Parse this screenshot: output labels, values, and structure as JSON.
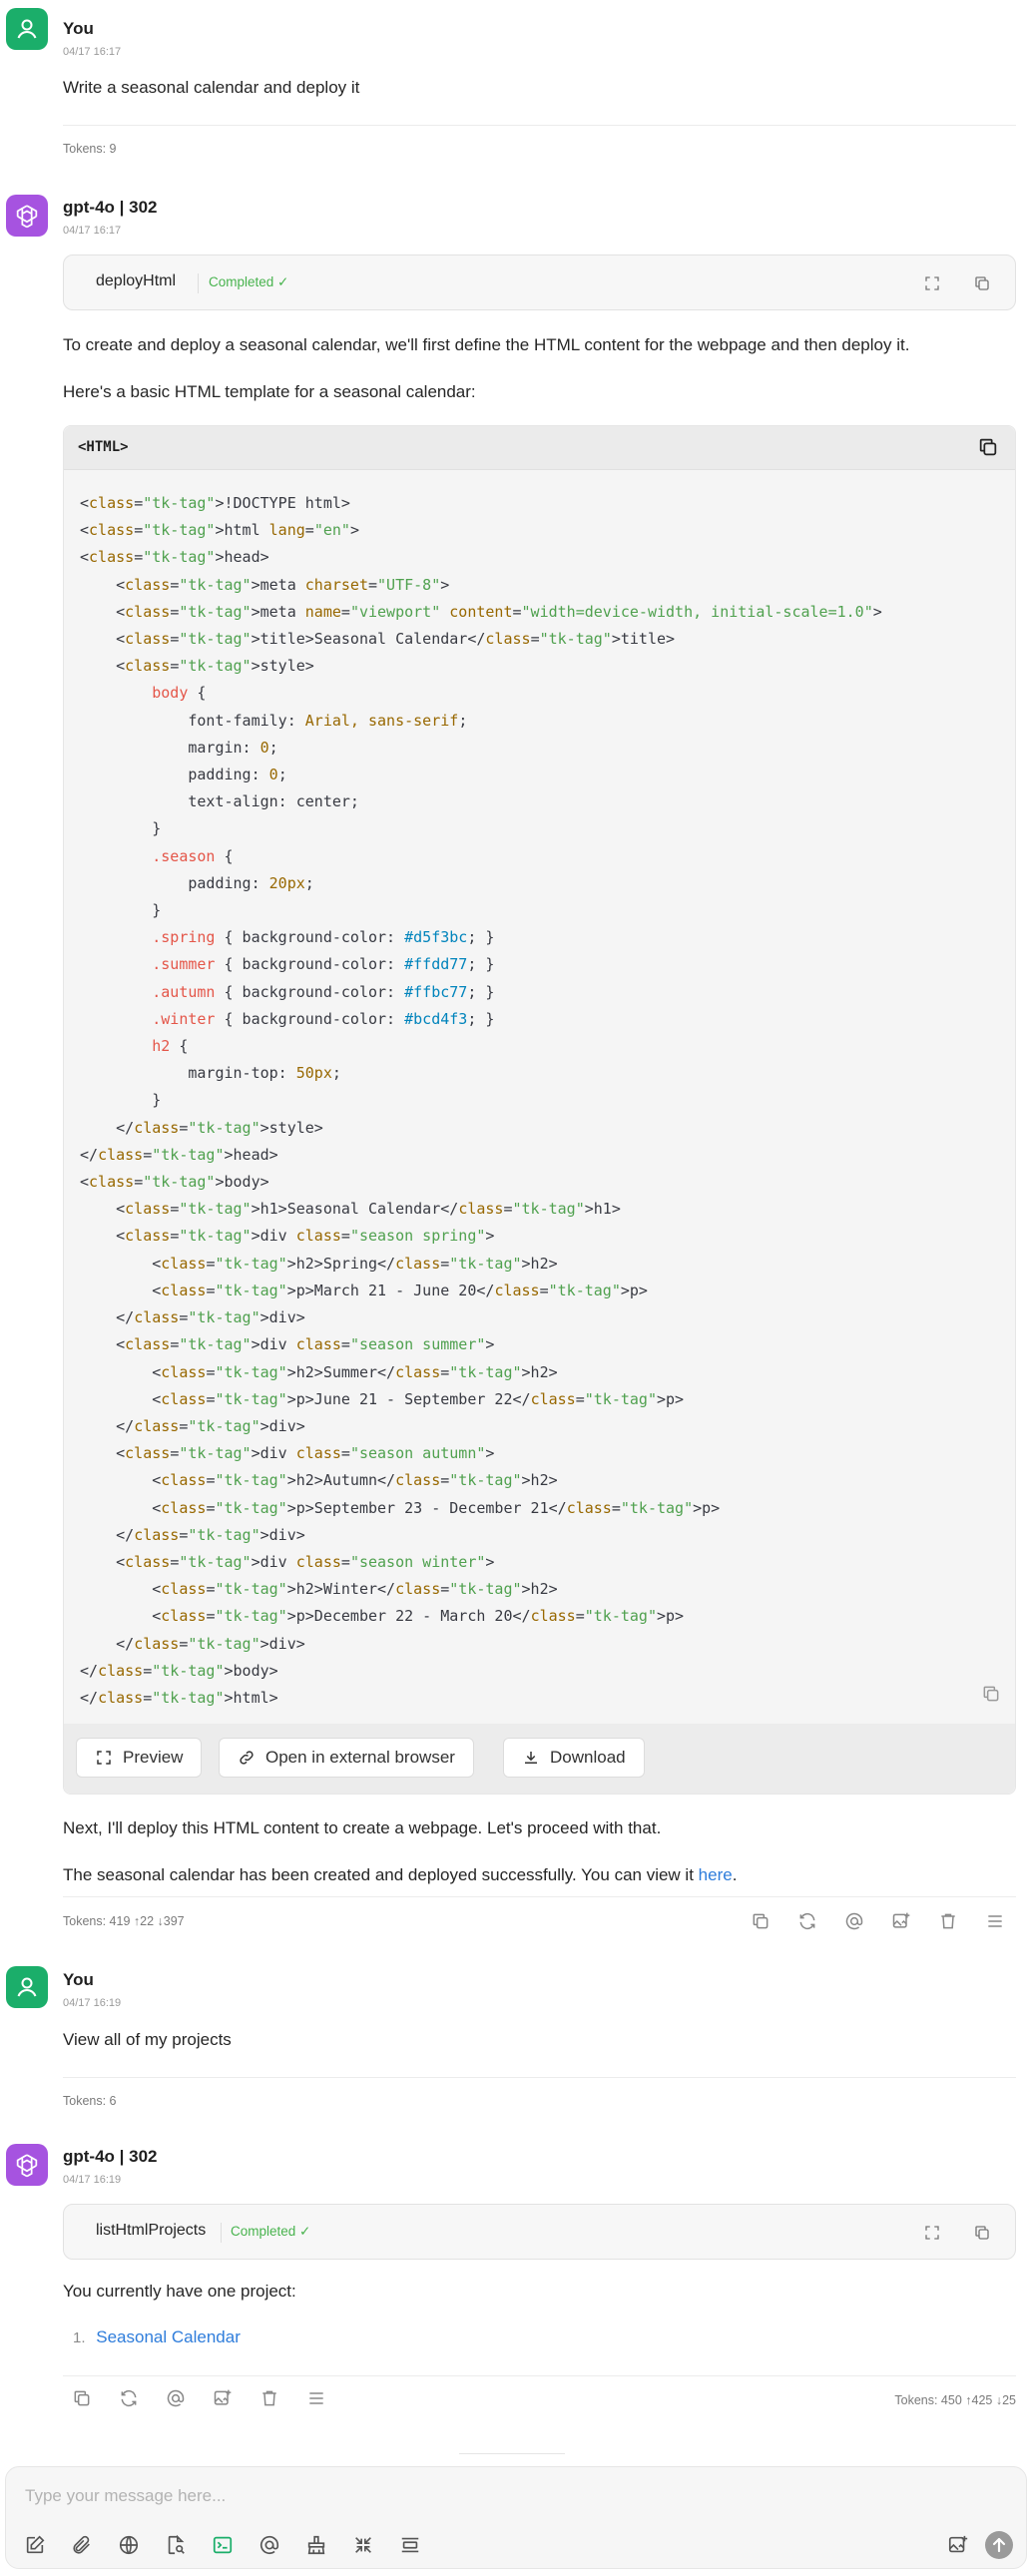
{
  "messages": {
    "m1": {
      "author": "You",
      "time": "04/17 16:17",
      "text": "Write a seasonal calendar and deploy it",
      "tokens": "Tokens: 9"
    },
    "m2": {
      "author": "gpt-4o | 302",
      "time": "04/17 16:17",
      "tool_name": "deployHtml",
      "tool_status": "Completed ✓",
      "p1": "To create and deploy a seasonal calendar, we'll first define the HTML content for the webpage and then deploy it.",
      "p2": "Here's a basic HTML template for a seasonal calendar:",
      "code_lang": "<HTML>",
      "code_lines": {
        "l1": "<!DOCTYPE html>",
        "l2": "<html lang=\"en\">",
        "l3": "<head>",
        "l4": "    <meta charset=\"UTF-8\">",
        "l5": "    <meta name=\"viewport\" content=\"width=device-width, initial-scale=1.0\">",
        "l6": "    <title>Seasonal Calendar</title>",
        "l7": "    <style>",
        "l8": "        body {",
        "l9": "            font-family: Arial, sans-serif;",
        "l10": "            margin: 0;",
        "l11": "            padding: 0;",
        "l12": "            text-align: center;",
        "l13": "        }",
        "l14": "        .season {",
        "l15": "            padding: 20px;",
        "l16": "        }",
        "l17": "        .spring { background-color: #d5f3bc; }",
        "l18": "        .summer { background-color: #ffdd77; }",
        "l19": "        .autumn { background-color: #ffbc77; }",
        "l20": "        .winter { background-color: #bcd4f3; }",
        "l21": "        h2 {",
        "l22": "            margin-top: 50px;",
        "l23": "        }",
        "l24": "    </style>",
        "l25": "</head>",
        "l26": "<body>",
        "l27": "    <h1>Seasonal Calendar</h1>",
        "l28": "    <div class=\"season spring\">",
        "l29": "        <h2>Spring</h2>",
        "l30": "        <p>March 21 - June 20</p>",
        "l31": "    </div>",
        "l32": "    <div class=\"season summer\">",
        "l33": "        <h2>Summer</h2>",
        "l34": "        <p>June 21 - September 22</p>",
        "l35": "    </div>",
        "l36": "    <div class=\"season autumn\">",
        "l37": "        <h2>Autumn</h2>",
        "l38": "        <p>September 23 - December 21</p>",
        "l39": "    </div>",
        "l40": "    <div class=\"season winter\">",
        "l41": "        <h2>Winter</h2>",
        "l42": "        <p>December 22 - March 20</p>",
        "l43": "    </div>",
        "l44": "</body>",
        "l45": "</html>"
      },
      "preview_label": "Preview",
      "open_external_label": "Open in external browser",
      "download_label": "Download",
      "p3": "Next, I'll deploy this HTML content to create a webpage. Let's proceed with that.",
      "p4_before": "The seasonal calendar has been created and deployed successfully. You can view it ",
      "p4_link": "here",
      "p4_after": ".",
      "tokens": "Tokens: 419 ↑22 ↓397"
    },
    "m3": {
      "author": "You",
      "time": "04/17 16:19",
      "text": "View all of my projects",
      "tokens": "Tokens: 6"
    },
    "m4": {
      "author": "gpt-4o | 302",
      "time": "04/17 16:19",
      "tool_name": "listHtmlProjects",
      "tool_status": "Completed ✓",
      "p1": "You currently have one project:",
      "list_num": "1.",
      "list_item": "Seasonal Calendar",
      "tokens": "Tokens: 450 ↑425 ↓25"
    }
  },
  "input": {
    "placeholder": "Type your message here..."
  },
  "colors": {
    "user_avatar": "#1bae6a",
    "ai_avatar": "#a653e0",
    "success": "#48b34e",
    "link": "#2f7ddb"
  }
}
